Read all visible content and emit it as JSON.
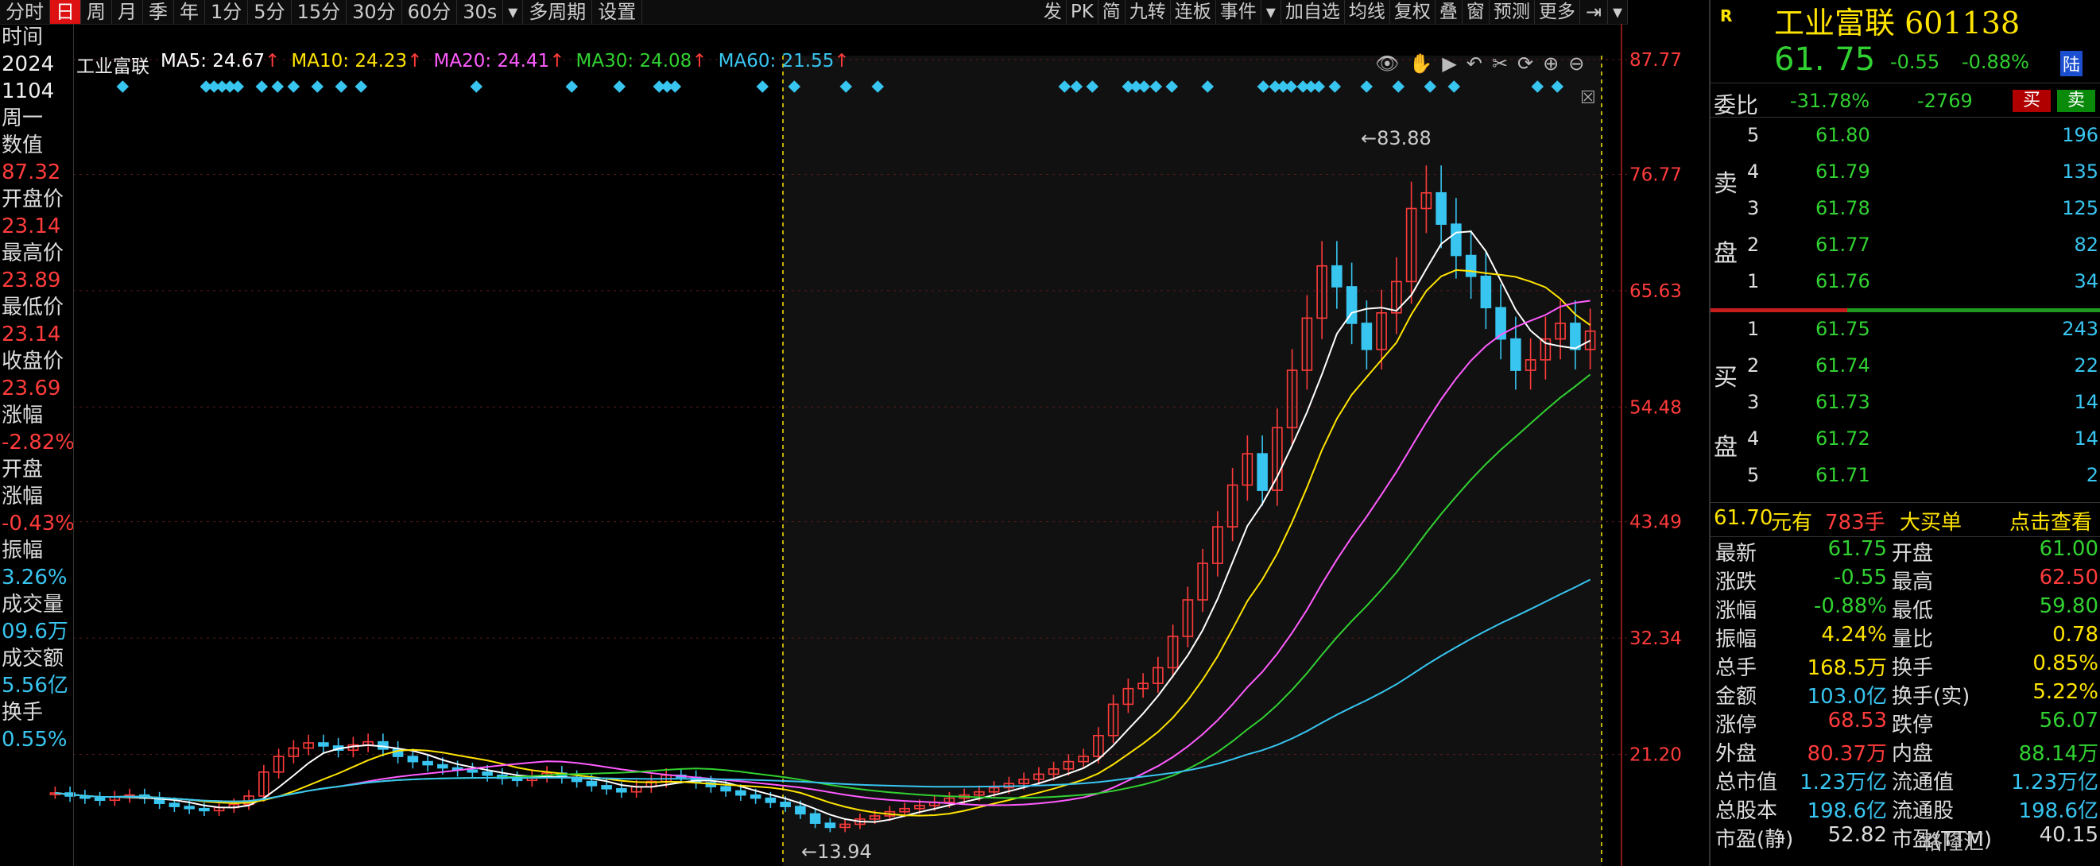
{
  "toolbar": {
    "periods": [
      "分时",
      "日",
      "周",
      "月",
      "季",
      "年",
      "1分",
      "5分",
      "15分",
      "30分",
      "60分",
      "30s"
    ],
    "active_period": "日",
    "tools": [
      "多周期",
      "设置"
    ],
    "right_tools": [
      "发",
      "PK",
      "简",
      "九转",
      "连板",
      "事件",
      "加自选",
      "均线",
      "复权",
      "叠",
      "窗",
      "预测",
      "更多"
    ]
  },
  "left_info": {
    "items": [
      {
        "label": "时间",
        "value": "2024"
      },
      {
        "label": "",
        "value": "1104"
      },
      {
        "label": "周一",
        "value": ""
      },
      {
        "label": "数值",
        "value": "87.32"
      },
      {
        "label": "开盘价",
        "value": "23.14"
      },
      {
        "label": "最高价",
        "value": "23.89"
      },
      {
        "label": "最低价",
        "value": "23.14"
      },
      {
        "label": "收盘价",
        "value": "23.69"
      },
      {
        "label": "涨幅",
        "value": "-2.82%"
      },
      {
        "label": "开盘",
        "value": ""
      },
      {
        "label": "涨幅",
        "value": "-0.43%"
      },
      {
        "label": "振幅",
        "value": "3.26%"
      },
      {
        "label": "成交量",
        "value": "09.6万"
      },
      {
        "label": "成交额",
        "value": "5.56亿"
      },
      {
        "label": "换手",
        "value": "0.55%"
      }
    ]
  },
  "chart": {
    "stock_label": "工业富联",
    "ma_legend": [
      {
        "name": "MA5",
        "value": "24.67",
        "arrow": "↑",
        "color": "#ffffff"
      },
      {
        "name": "MA10",
        "value": "24.23",
        "arrow": "↑",
        "color": "#ffe400"
      },
      {
        "name": "MA20",
        "value": "24.41",
        "arrow": "↑",
        "color": "#ff5cff"
      },
      {
        "name": "MA30",
        "value": "24.08",
        "arrow": "↑",
        "color": "#31d131"
      },
      {
        "name": "MA60",
        "value": "21.55",
        "arrow": "↑",
        "color": "#38c5f0"
      }
    ],
    "max_label": "83.88",
    "min_label": "13.94"
  },
  "chart_data": {
    "type": "candlestick",
    "title": "工业富联",
    "y_ticks": [
      "87.77",
      "76.77",
      "65.63",
      "54.48",
      "43.49",
      "32.34",
      "21.20"
    ],
    "ylim": [
      10.5,
      87.77
    ],
    "grid": true,
    "series_points": {
      "close_approx": [
        17.5,
        17.2,
        17.0,
        16.8,
        17.1,
        17.3,
        17.0,
        16.5,
        16.2,
        16.0,
        15.8,
        16.1,
        16.4,
        17.2,
        19.5,
        21.0,
        21.8,
        22.3,
        22.0,
        21.6,
        22.1,
        22.4,
        21.7,
        21.0,
        20.5,
        20.2,
        19.9,
        19.7,
        19.5,
        19.2,
        18.9,
        18.7,
        19.1,
        19.4,
        19.0,
        18.6,
        18.2,
        17.9,
        17.6,
        18.1,
        18.6,
        19.2,
        19.0,
        18.5,
        18.1,
        17.7,
        17.3,
        17.0,
        16.6,
        16.2,
        15.5,
        14.6,
        14.2,
        14.5,
        15.0,
        15.3,
        15.7,
        16.0,
        16.3,
        16.6,
        17.0,
        17.3,
        17.6,
        18.0,
        18.4,
        18.8,
        19.3,
        19.8,
        20.5,
        21.0,
        23.0,
        26.0,
        27.5,
        28.0,
        29.5,
        32.5,
        36.0,
        39.5,
        43.0,
        47.0,
        50.0,
        46.5,
        52.5,
        58.0,
        63.0,
        68.0,
        66.0,
        62.5,
        60.0,
        63.5,
        66.5,
        73.5,
        75.0,
        72.0,
        69.0,
        67.0,
        64.0,
        61.0,
        58.0,
        59.0,
        61.0,
        62.5,
        60.0,
        61.75
      ]
    },
    "ma_series": [
      {
        "name": "MA5",
        "value_last": 24.67
      },
      {
        "name": "MA10",
        "value_last": 24.23
      },
      {
        "name": "MA20",
        "value_last": 24.41
      },
      {
        "name": "MA30",
        "value_last": 24.08
      },
      {
        "name": "MA60",
        "value_last": 21.55
      }
    ]
  },
  "quote": {
    "badge": "R",
    "name": "工业富联 601138",
    "price": "61. 75",
    "change": "-0.55",
    "change_pct": "-0.88%",
    "market_tag": "陆",
    "weibi_label": "委比",
    "weibi_pct": "-31.78%",
    "weibi_diff": "-2769",
    "buy_btn": "买",
    "sell_btn": "卖",
    "sell_side_label": [
      "卖",
      "盘"
    ],
    "buy_side_label": [
      "买",
      "盘"
    ],
    "asks": [
      {
        "level": "5",
        "price": "61.80",
        "vol": "196"
      },
      {
        "level": "4",
        "price": "61.79",
        "vol": "135"
      },
      {
        "level": "3",
        "price": "61.78",
        "vol": "125"
      },
      {
        "level": "2",
        "price": "61.77",
        "vol": "82"
      },
      {
        "level": "1",
        "price": "61.76",
        "vol": "34"
      }
    ],
    "bids": [
      {
        "level": "1",
        "price": "61.75",
        "vol": "243"
      },
      {
        "level": "2",
        "price": "61.74",
        "vol": "22"
      },
      {
        "level": "3",
        "price": "61.73",
        "vol": "14"
      },
      {
        "level": "4",
        "price": "61.72",
        "vol": "14"
      },
      {
        "level": "5",
        "price": "61.71",
        "vol": "2"
      }
    ],
    "bigorder": {
      "price": "61.70",
      "text1": "元有",
      "lots": "783手",
      "text2": "大买单",
      "link": "点击查看"
    },
    "stats": [
      {
        "k1": "最新",
        "v1": "61.75",
        "c1": "#31d131",
        "k2": "开盘",
        "v2": "61.00",
        "c2": "#31d131"
      },
      {
        "k1": "涨跌",
        "v1": "-0.55",
        "c1": "#31d131",
        "k2": "最高",
        "v2": "62.50",
        "c2": "#ff3b3b"
      },
      {
        "k1": "涨幅",
        "v1": "-0.88%",
        "c1": "#31d131",
        "k2": "最低",
        "v2": "59.80",
        "c2": "#31d131"
      },
      {
        "k1": "振幅",
        "v1": "4.24%",
        "c1": "#ffe400",
        "k2": "量比",
        "v2": "0.78",
        "c2": "#ffe400"
      },
      {
        "k1": "总手",
        "v1": "168.5万",
        "c1": "#ffe400",
        "k2": "换手",
        "v2": "0.85%",
        "c2": "#ffe400"
      },
      {
        "k1": "金额",
        "v1": "103.0亿",
        "c1": "#38c5f0",
        "k2": "换手(实)",
        "v2": "5.22%",
        "c2": "#ffe400"
      },
      {
        "k1": "涨停",
        "v1": "68.53",
        "c1": "#ff3b3b",
        "k2": "跌停",
        "v2": "56.07",
        "c2": "#31d131"
      },
      {
        "k1": "外盘",
        "v1": "80.37万",
        "c1": "#ff3b3b",
        "k2": "内盘",
        "v2": "88.14万",
        "c2": "#31d131"
      },
      {
        "k1": "总市值",
        "v1": "1.23万亿",
        "c1": "#38c5f0",
        "k2": "流通值",
        "v2": "1.23万亿",
        "c2": "#38c5f0"
      },
      {
        "k1": "总股本",
        "v1": "198.6亿",
        "c1": "#38c5f0",
        "k2": "流通股",
        "v2": "198.6亿",
        "c2": "#38c5f0"
      },
      {
        "k1": "市盈(静)",
        "v1": "52.82",
        "c1": "#ddd",
        "k2": "市盈(TTM)",
        "v2": "40.15",
        "c2": "#ddd"
      }
    ]
  },
  "watermark": "格隆汇"
}
